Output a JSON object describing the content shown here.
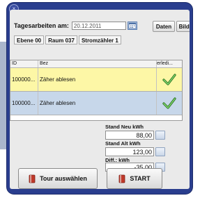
{
  "window": {
    "close_glyph": "×"
  },
  "header": {
    "label": "Tagesarbeiten am:",
    "date_value": "20.12.2011",
    "btn_daten": "Daten",
    "btn_bilder": "Bilder"
  },
  "crumbs": [
    "Ebene 00",
    "Raum 037",
    "Stromzähler 1"
  ],
  "table": {
    "columns": [
      "ID",
      "Bez",
      "erledi..."
    ],
    "rows": [
      {
        "id": "100000...",
        "bez": "Zäher ablesen",
        "done": true,
        "color": "#fdf7a6"
      },
      {
        "id": "100000...",
        "bez": "Zäher ablesen",
        "done": true,
        "color": "#c7d7ea"
      }
    ]
  },
  "meter": {
    "neu_label": "Stand Neu kWh",
    "neu_value": "88,00",
    "alt_label": "Stand Alt kWh",
    "alt_value": "123,00",
    "diff_label": "Diff.: kWh",
    "diff_value": "-35,00"
  },
  "actions": {
    "tour_label": "Tour auswählen",
    "start_label": "START"
  },
  "colors": {
    "frame": "#2a3e8e",
    "accent_red": "#c0392b",
    "check_green": "#3a9b2e"
  },
  "icons": {
    "calendar": "calendar-icon",
    "check": "checkmark-icon",
    "book": "book-icon",
    "close": "close-icon"
  }
}
